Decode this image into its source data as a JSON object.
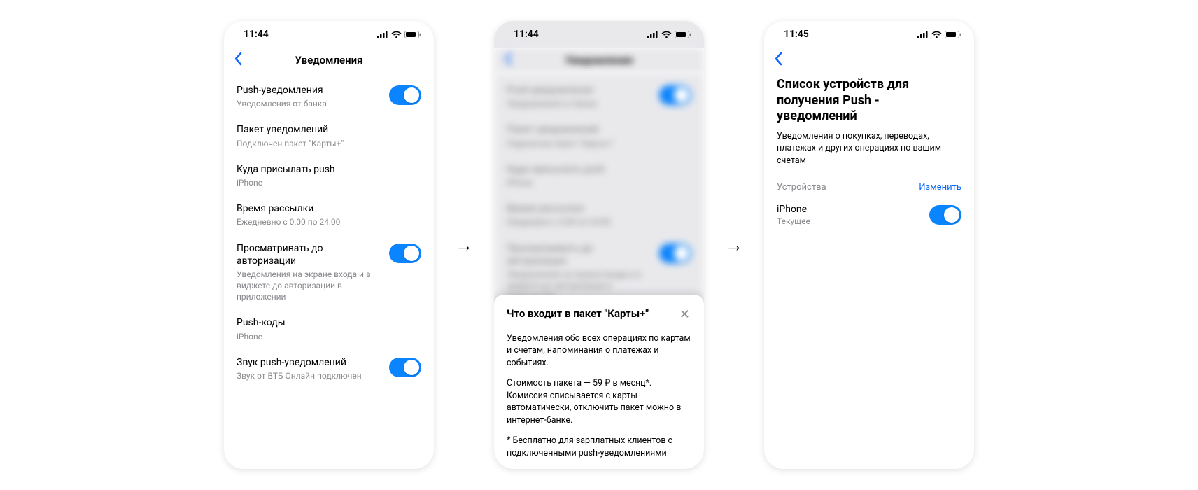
{
  "screen1": {
    "time": "11:44",
    "nav_title": "Уведомления",
    "rows": [
      {
        "title": "Push-уведомления",
        "sub": "Уведомления от банка",
        "toggle": true
      },
      {
        "title": "Пакет уведомлений",
        "sub": "Подключен пакет \"Карты+\"",
        "toggle": false
      },
      {
        "title": "Куда присылать push",
        "sub": "iPhone",
        "toggle": false
      },
      {
        "title": "Время рассылки",
        "sub": "Ежедневно с 0:00 по 24:00",
        "toggle": false
      },
      {
        "title": "Просматривать до авторизации",
        "sub": "Уведомления на экране входа и в виджете до авторизации в приложении",
        "toggle": true
      },
      {
        "title": "Push-коды",
        "sub": "iPhone",
        "toggle": false
      },
      {
        "title": "Звук push-уведомлений",
        "sub": "Звук от ВТБ Онлайн подключен",
        "toggle": true
      }
    ]
  },
  "screen2": {
    "time": "11:44",
    "nav_title": "Уведомления",
    "sheet_title": "Что входит в пакет \"Карты+\"",
    "sheet_p1": "Уведомления обо всех операциях по картам и счетам, напоминания о платежах и событиях.",
    "sheet_p2": "Стоимость пакета — 59 ₽ в месяц*. Комиссия списывается с карты автоматически, отключить пакет можно в интернет-банке.",
    "sheet_p3": "* Бесплатно для зарплатных клиентов с подключенными push-уведомлениями"
  },
  "screen3": {
    "time": "11:45",
    "page_title": "Список устройств для получения Push - уведомлений",
    "page_sub": "Уведомления о покупках, переводах, платежах и других операциях по вашим счетам",
    "section_label": "Устройства",
    "section_action": "Изменить",
    "device_name": "iPhone",
    "device_sub": "Текущее"
  }
}
